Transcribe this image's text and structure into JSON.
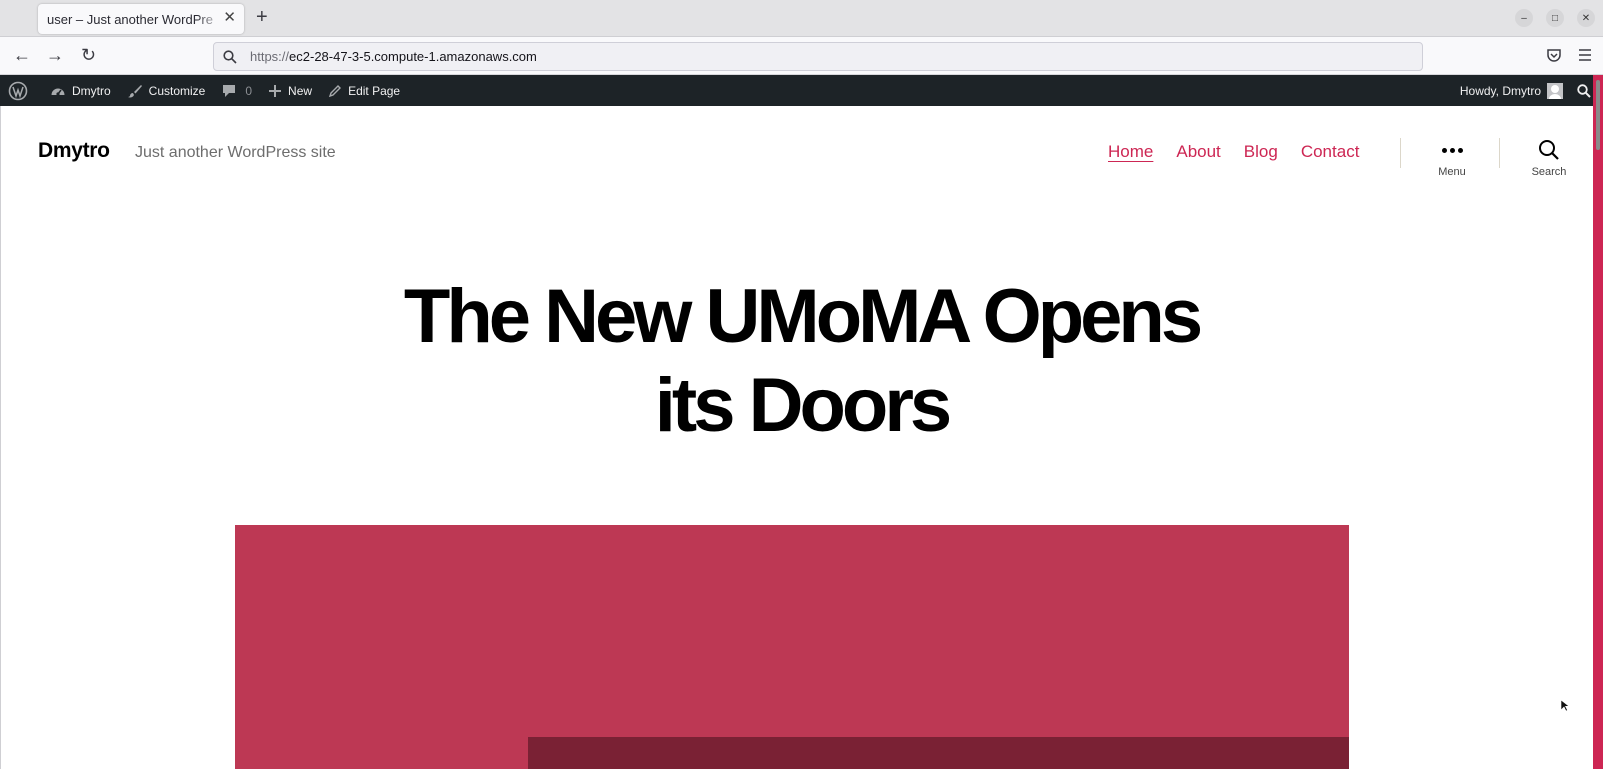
{
  "browser": {
    "tab_title": "user – Just another WordPre",
    "tab_close": "✕",
    "new_tab": "+",
    "url_protocol": "https://",
    "url_host": "ec2-28-47-3-5.compute-1.amazonaws.com",
    "back": "←",
    "forward": "→",
    "reload": "↻",
    "minimize": "–",
    "maximize": "□",
    "close": "✕"
  },
  "adminbar": {
    "site_name": "Dmytro",
    "customize": "Customize",
    "comments_count": "0",
    "new": "New",
    "edit_page": "Edit Page",
    "howdy": "Howdy, Dmytro"
  },
  "site": {
    "title": "Dmytro",
    "description": "Just another WordPress site",
    "menu": [
      {
        "label": "Home",
        "current": true
      },
      {
        "label": "About"
      },
      {
        "label": "Blog"
      },
      {
        "label": "Contact"
      }
    ],
    "menu_toggle_label": "Menu",
    "search_toggle_label": "Search",
    "accent_color": "#cd2653"
  },
  "page": {
    "title_line1": "The New UMoMA Opens",
    "title_line2": "its Doors",
    "hero_color": "#bd3854",
    "hero_inner_color": "#7a2134"
  }
}
